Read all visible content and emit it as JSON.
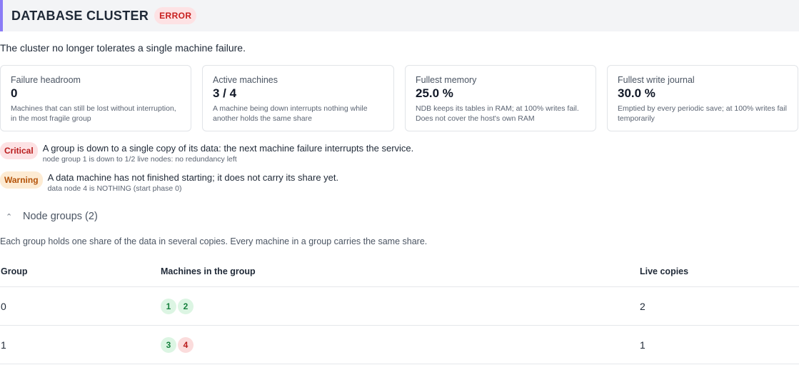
{
  "header": {
    "title": "DATABASE CLUSTER",
    "status": "ERROR"
  },
  "summary": "The cluster no longer tolerates a single machine failure.",
  "cards": [
    {
      "label": "Failure headroom",
      "value": "0",
      "description": "Machines that can still be lost without interruption, in the most fragile group"
    },
    {
      "label": "Active machines",
      "value": "3 / 4",
      "description": "A machine being down interrupts nothing while another holds the same share"
    },
    {
      "label": "Fullest memory",
      "value": "25.0 %",
      "description": "NDB keeps its tables in RAM; at 100% writes fail. Does not cover the host's own RAM"
    },
    {
      "label": "Fullest write journal",
      "value": "30.0 %",
      "description": "Emptied by every periodic save; at 100% writes fail temporarily"
    }
  ],
  "alerts": [
    {
      "severity": "Critical",
      "message": "A group is down to a single copy of its data: the next machine failure interrupts the service.",
      "detail": "node group 1 is down to 1/2 live nodes: no redundancy left"
    },
    {
      "severity": "Warning",
      "message": "A data machine has not finished starting; it does not carry its share yet.",
      "detail": "data node 4 is NOTHING (start phase 0)"
    }
  ],
  "node_groups": {
    "toggle_label": "Node groups (2)",
    "expanded": true,
    "description": "Each group holds one share of the data in several copies. Every machine in a group carries the same share.",
    "columns": [
      "Group",
      "Machines in the group",
      "Live copies"
    ],
    "rows": [
      {
        "group": "0",
        "nodes": [
          {
            "id": "1",
            "status": "up"
          },
          {
            "id": "2",
            "status": "up"
          }
        ],
        "live": "2"
      },
      {
        "group": "1",
        "nodes": [
          {
            "id": "3",
            "status": "up"
          },
          {
            "id": "4",
            "status": "down"
          }
        ],
        "live": "1"
      }
    ]
  },
  "colors": {
    "accent": "#8b7cf6",
    "error": "#c81e1e",
    "warning": "#b45309",
    "node_up": "#15803d",
    "node_down": "#b91c1c"
  }
}
